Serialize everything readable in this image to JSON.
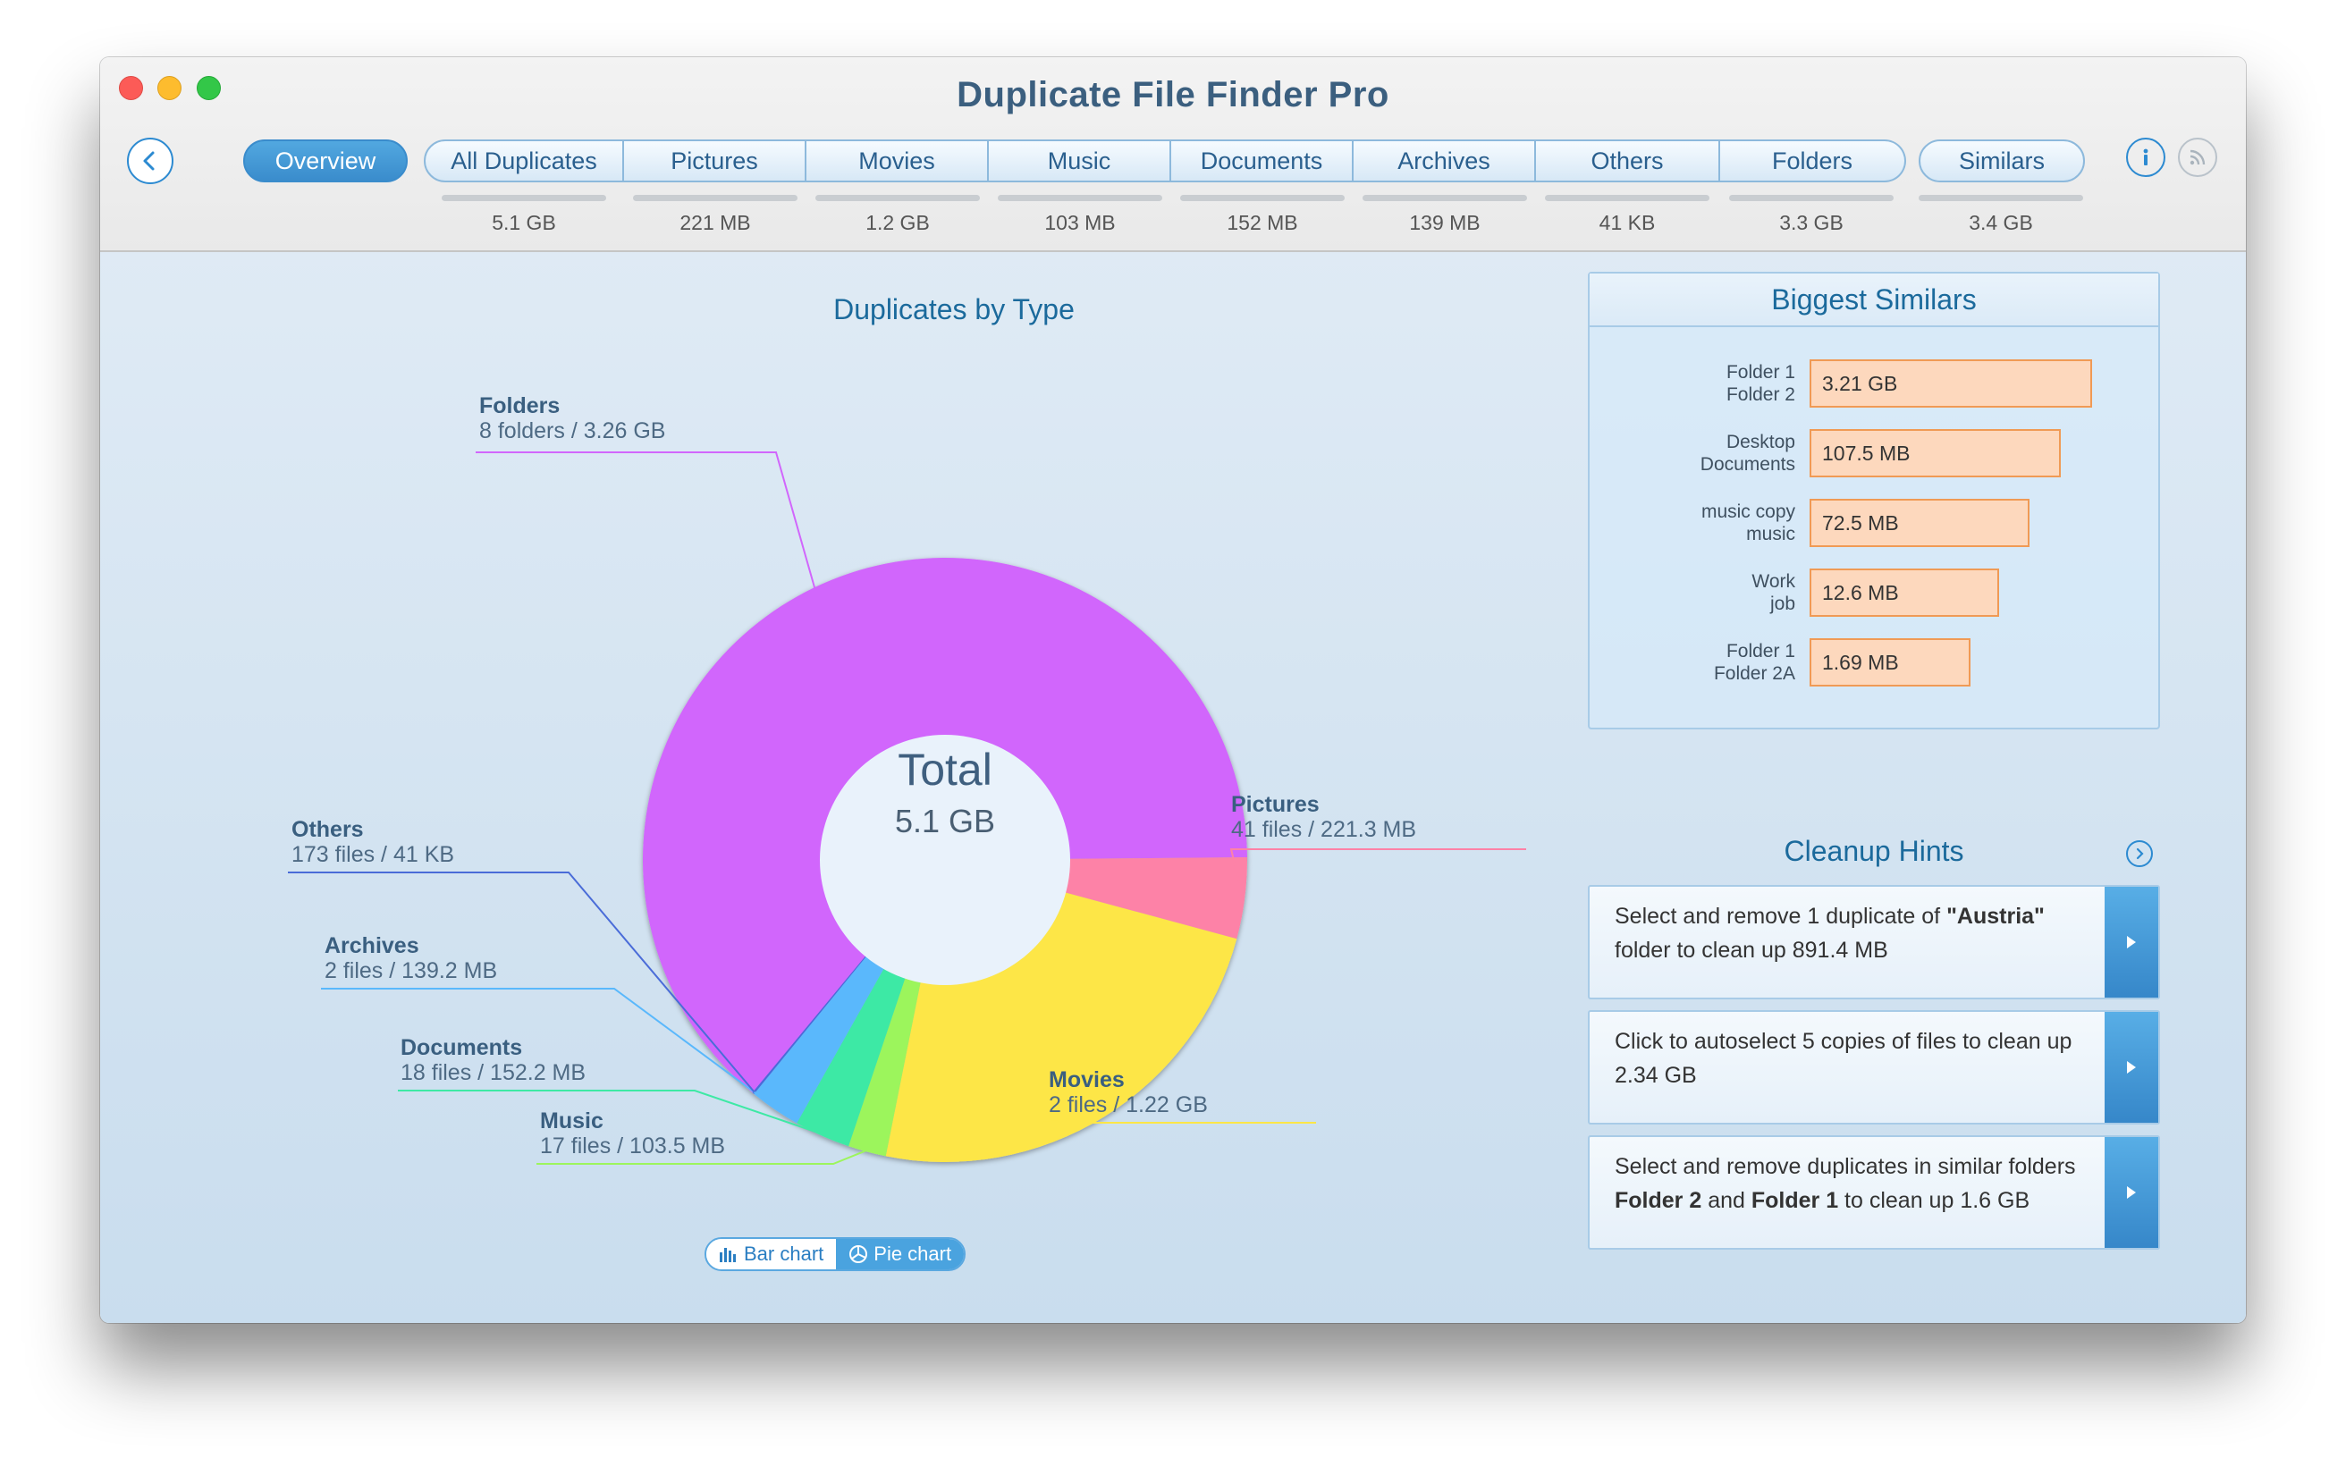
{
  "window": {
    "title": "Duplicate File Finder Pro"
  },
  "tabs": {
    "overview": "Overview",
    "items": [
      {
        "label": "All Duplicates",
        "size": "5.1 GB"
      },
      {
        "label": "Pictures",
        "size": "221 MB"
      },
      {
        "label": "Movies",
        "size": "1.2 GB"
      },
      {
        "label": "Music",
        "size": "103 MB"
      },
      {
        "label": "Documents",
        "size": "152 MB"
      },
      {
        "label": "Archives",
        "size": "139 MB"
      },
      {
        "label": "Others",
        "size": "41 KB"
      },
      {
        "label": "Folders",
        "size": "3.3 GB"
      }
    ],
    "similars": {
      "label": "Similars",
      "size": "3.4 GB"
    }
  },
  "icons": {
    "back": "chevron-left-icon",
    "info": "info-icon",
    "rss": "rss-icon"
  },
  "chart_data": {
    "type": "pie",
    "title": "Duplicates by Type",
    "center": {
      "label": "Total",
      "value": "5.1 GB"
    },
    "slices": [
      {
        "name": "Folders",
        "detail": "8 folders / 3.26 GB",
        "value": 3.26,
        "color": "#d166fc"
      },
      {
        "name": "Pictures",
        "detail": "41 files / 221.3 MB",
        "value": 0.2213,
        "color": "#fd82a7"
      },
      {
        "name": "Movies",
        "detail": "2 files / 1.22 GB",
        "value": 1.22,
        "color": "#fde647"
      },
      {
        "name": "Music",
        "detail": "17 files / 103.5 MB",
        "value": 0.1035,
        "color": "#9cf55c"
      },
      {
        "name": "Documents",
        "detail": "18 files / 152.2 MB",
        "value": 0.1522,
        "color": "#3ee9a5"
      },
      {
        "name": "Archives",
        "detail": "2 files / 139.2 MB",
        "value": 0.1392,
        "color": "#5ab8fc"
      },
      {
        "name": "Others",
        "detail": "173 files / 41 KB",
        "value": 4.1e-05,
        "color": "#4a6cd8"
      }
    ]
  },
  "view_toggle": {
    "bar": "Bar chart",
    "pie": "Pie chart",
    "selected": "pie"
  },
  "similars_panel": {
    "title": "Biggest Similars",
    "rows": [
      {
        "a": "Folder 1",
        "b": "Folder 2",
        "size": "3.21 GB",
        "fill": 1.0
      },
      {
        "a": "Desktop",
        "b": "Documents",
        "size": "107.5 MB",
        "fill": 0.89
      },
      {
        "a": "music copy",
        "b": "music",
        "size": "72.5 MB",
        "fill": 0.78
      },
      {
        "a": "Work",
        "b": "job",
        "size": "12.6 MB",
        "fill": 0.67
      },
      {
        "a": "Folder 1",
        "b": "Folder 2A",
        "size": "1.69 MB",
        "fill": 0.57
      }
    ]
  },
  "cleanup_hints": {
    "title": "Cleanup Hints",
    "hints": [
      {
        "parts": [
          [
            "Select and remove 1 duplicate of ",
            false
          ],
          [
            "\"Austria\"",
            true
          ],
          [
            " folder to clean up 891.4 MB",
            false
          ]
        ]
      },
      {
        "parts": [
          [
            "Click to autoselect 5 copies of files to clean up 2.34 GB",
            false
          ]
        ]
      },
      {
        "parts": [
          [
            "Select and remove duplicates in similar folders ",
            false
          ],
          [
            "Folder 2",
            true
          ],
          [
            " and ",
            false
          ],
          [
            "Folder 1",
            true
          ],
          [
            " to clean up 1.6 GB",
            false
          ]
        ]
      }
    ]
  },
  "colors": {
    "accent": "#3a8ccc",
    "title": "#3b5f7f",
    "bar_fill": "#fdd8bd",
    "bar_border": "#f09a55"
  }
}
